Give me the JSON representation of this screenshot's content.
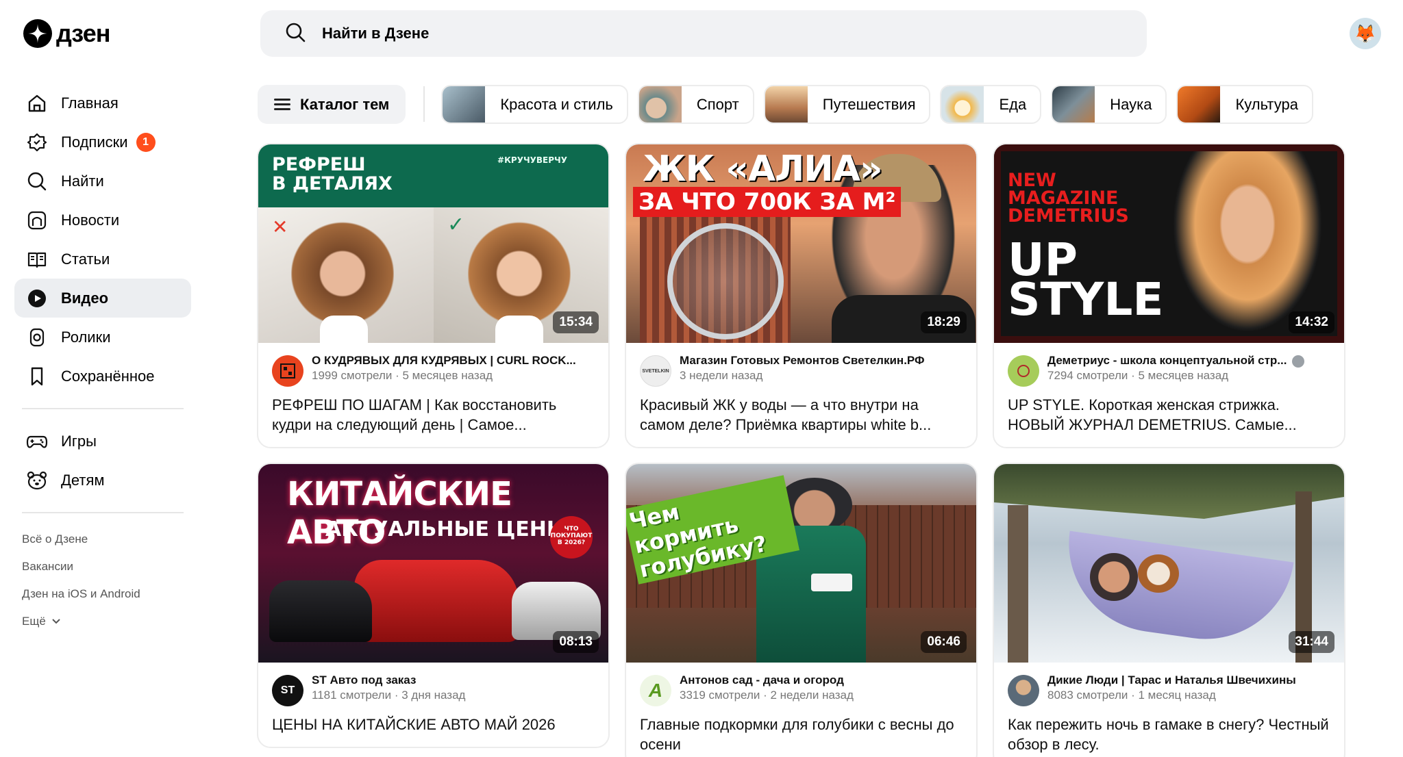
{
  "logo": {
    "text": "дзен"
  },
  "search": {
    "placeholder": "Найти в Дзене"
  },
  "sidebar": {
    "items": [
      {
        "label": "Главная",
        "icon": "home-icon"
      },
      {
        "label": "Подписки",
        "icon": "subscriptions-icon",
        "badge": "1"
      },
      {
        "label": "Найти",
        "icon": "search-icon"
      },
      {
        "label": "Новости",
        "icon": "news-icon"
      },
      {
        "label": "Статьи",
        "icon": "articles-icon"
      },
      {
        "label": "Видео",
        "icon": "video-icon",
        "active": true
      },
      {
        "label": "Ролики",
        "icon": "shorts-icon"
      },
      {
        "label": "Сохранённое",
        "icon": "bookmark-icon"
      }
    ],
    "secondary": [
      {
        "label": "Игры",
        "icon": "gamepad-icon"
      },
      {
        "label": "Детям",
        "icon": "kids-icon"
      }
    ],
    "footer": [
      "Всё о Дзене",
      "Вакансии",
      "Дзен на iOS и Android",
      "Ещё"
    ]
  },
  "topics": {
    "catalog_label": "Каталог тем",
    "chips": [
      {
        "label": "Красота и стиль",
        "color": "#6a8090"
      },
      {
        "label": "Спорт",
        "color": "#c9a48a"
      },
      {
        "label": "Путешествия",
        "color": "#c79a72"
      },
      {
        "label": "Еда",
        "color": "#d9c9a0"
      },
      {
        "label": "Наука",
        "color": "#5a6e7a"
      },
      {
        "label": "Культура",
        "color": "#d46a2a"
      }
    ]
  },
  "videos": [
    {
      "channel": "О КУДРЯВЫХ ДЛЯ КУДРЯВЫХ | CURL ROCK...",
      "views": "1999 смотрели",
      "age": "5 месяцев назад",
      "title": "РЕФРЕШ ПО ШАГАМ | Как восстановить кудри на следующий день | Самое...",
      "duration": "15:34",
      "thumb_overlay": "РЕФРЕШ\nВ ДЕТАЛЯХ",
      "thumb_tag": "#КРУЧУВЕРЧУ",
      "logo_color": "#e8431e"
    },
    {
      "channel": "Магазин Готовых Ремонтов Светелкин.РФ",
      "views": "",
      "age": "3 недели назад",
      "title": "Красивый ЖК у воды — а что внутри на самом деле? Приёмка квартиры white b...",
      "duration": "18:29",
      "thumb_overlay": "ЖК «АЛИА»",
      "thumb_overlay2": "ЗА ЧТО 700К ЗА М²",
      "logo_text": "SVETELKIN",
      "logo_color": "#eeeeee"
    },
    {
      "channel": "Деметриус - школа концептуальной стр...",
      "views": "7294 смотрели",
      "age": "5 месяцев назад",
      "title": "UP STYLE. Короткая женская стрижка. НОВЫЙ ЖУРНАЛ DEMETRIUS. Самые...",
      "duration": "14:32",
      "thumb_overlay": "NEW\nMAGAZINE\nDEMETRIUS",
      "thumb_overlay2": "UP\nSTYLE",
      "logo_color": "#8ab84a"
    },
    {
      "channel": "ST Авто под заказ",
      "views": "1181 смотрели",
      "age": "3 дня назад",
      "title": "ЦЕНЫ НА КИТАЙСКИЕ АВТО МАЙ 2026",
      "duration": "08:13",
      "thumb_overlay": "КИТАЙСКИЕ АВТО",
      "thumb_overlay2": "АКТУАЛЬНЫЕ ЦЕНЫ",
      "thumb_badge": "ЧТО ПОКУПАЮТ В 2026?",
      "logo_text": "ST",
      "logo_color": "#111111"
    },
    {
      "channel": "Антонов сад - дача и огород",
      "views": "3319 смотрели",
      "age": "2 недели назад",
      "title": "Главные подкормки для голубики с весны до осени",
      "duration": "06:46",
      "thumb_overlay": "Чем кормить голубику?",
      "logo_text": "А",
      "logo_color": "#6aa52c"
    },
    {
      "channel": "Дикие Люди | Тарас и Наталья Швечихины",
      "views": "8083 смотрели",
      "age": "1 месяц назад",
      "title": "Как пережить ночь в гамаке в снегу? Честный обзор в лесу.",
      "duration": "31:44",
      "logo_color": "#7a8a98"
    }
  ]
}
